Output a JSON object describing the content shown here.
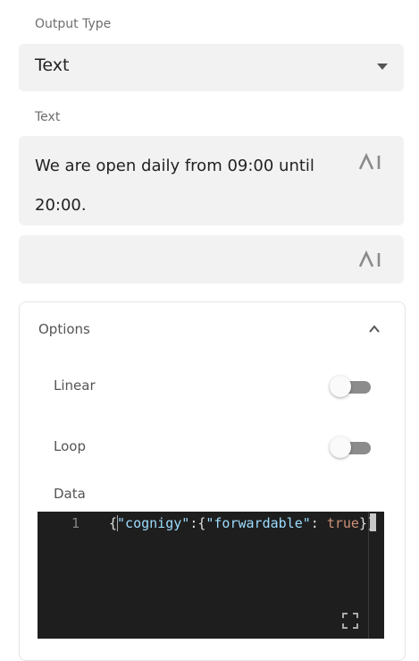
{
  "output_type": {
    "label": "Output Type",
    "value": "Text"
  },
  "text_field": {
    "label": "Text",
    "value": "We are open daily from 09:00 until 20:00.",
    "ai_label": "AI"
  },
  "empty_field": {
    "ai_label": "AI"
  },
  "options": {
    "title": "Options",
    "linear_label": "Linear",
    "loop_label": "Loop",
    "data_label": "Data",
    "editor": {
      "line_number": "1",
      "code_open": "{",
      "key1": "\"cognigy\"",
      "sep1": ":{",
      "key2": "\"forwardable\"",
      "sep2": ": ",
      "value": "true",
      "code_close": "}}"
    }
  }
}
